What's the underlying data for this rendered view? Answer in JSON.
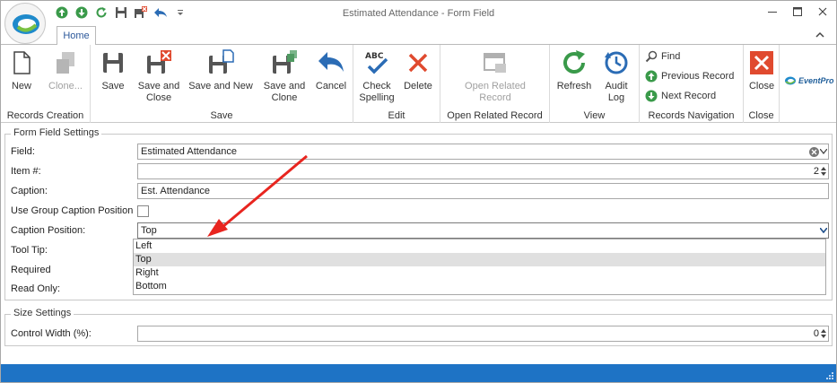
{
  "window": {
    "title": "Estimated Attendance - Form Field"
  },
  "tabs": [
    {
      "label": "Home",
      "active": true
    }
  ],
  "ribbon": {
    "groups": {
      "records_creation": {
        "label": "Records Creation",
        "new": "New",
        "clone": "Clone..."
      },
      "save": {
        "label": "Save",
        "save": "Save",
        "save_and_close": [
          "Save and",
          "Close"
        ],
        "save_and_new": "Save and New",
        "save_and_clone": [
          "Save and",
          "Clone"
        ],
        "cancel": "Cancel"
      },
      "edit": {
        "label": "Edit",
        "check_spelling": [
          "Check",
          "Spelling"
        ],
        "delete": "Delete"
      },
      "open_related": {
        "label": "Open Related Record",
        "open_related_record": [
          "Open Related",
          "Record"
        ]
      },
      "view": {
        "label": "View",
        "refresh": "Refresh",
        "audit_log": [
          "Audit",
          "Log"
        ]
      },
      "records_navigation": {
        "label": "Records Navigation",
        "find": "Find",
        "previous_record": "Previous Record",
        "next_record": "Next Record"
      },
      "close": {
        "label": "Close",
        "close": "Close"
      }
    },
    "brand_logo_text": "EventPro"
  },
  "form_field_settings": {
    "title": "Form Field Settings",
    "field": {
      "label": "Field:",
      "value": "Estimated Attendance"
    },
    "item_number": {
      "label": "Item #:",
      "value": "2"
    },
    "caption": {
      "label": "Caption:",
      "value": "Est. Attendance"
    },
    "use_group_caption_position": {
      "label": "Use Group Caption Position",
      "checked": false
    },
    "caption_position": {
      "label": "Caption Position:",
      "value": "Top",
      "options": [
        "Left",
        "Top",
        "Right",
        "Bottom"
      ],
      "highlighted": "Top"
    },
    "tool_tip": {
      "label": "Tool Tip:"
    },
    "required": {
      "label": "Required"
    },
    "read_only": {
      "label": "Read Only:"
    }
  },
  "size_settings": {
    "title": "Size Settings",
    "control_width": {
      "label": "Control Width (%):",
      "value": "0"
    }
  },
  "colors": {
    "accent": "#2b579a",
    "statusbar": "#1e73c5",
    "annotation_arrow": "#e8251f",
    "save_green": "#2e9e3f",
    "close_red": "#e04a2f"
  }
}
